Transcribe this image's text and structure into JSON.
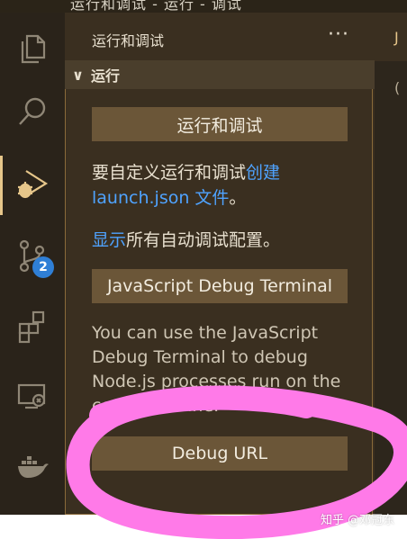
{
  "window": {
    "title_fragment": "运行和调试 - 运行 - 调试"
  },
  "activity_bar": {
    "items": [
      {
        "name": "explorer-icon"
      },
      {
        "name": "search-icon"
      },
      {
        "name": "run-debug-icon",
        "active": true
      },
      {
        "name": "source-control-icon",
        "badge": "2"
      },
      {
        "name": "extensions-icon"
      },
      {
        "name": "remote-explorer-icon"
      },
      {
        "name": "docker-icon"
      }
    ],
    "accent_color": "#e6c68a",
    "badge_color": "#2f7fd6"
  },
  "sidebar": {
    "title": "运行和调试",
    "more": "···",
    "section": {
      "chevron": "∨",
      "label": "运行"
    },
    "run_button": "运行和调试",
    "custom_text_prefix": "要自定义运行和调试",
    "custom_link": "创建 launch.json 文件",
    "custom_text_suffix": "。",
    "show_link": "显示",
    "show_text": "所有自动调试配置。",
    "js_terminal_button": "JavaScript Debug Terminal",
    "js_terminal_desc": "You can use the JavaScript Debug Terminal to debug Node.js processes run on the command line.",
    "debug_url_button": "Debug URL"
  },
  "right_panel": {
    "glyph": "J",
    "glyph2": "("
  },
  "annotation": {
    "color": "#ff7ae8"
  },
  "watermark": "知乎 @邓冠东"
}
